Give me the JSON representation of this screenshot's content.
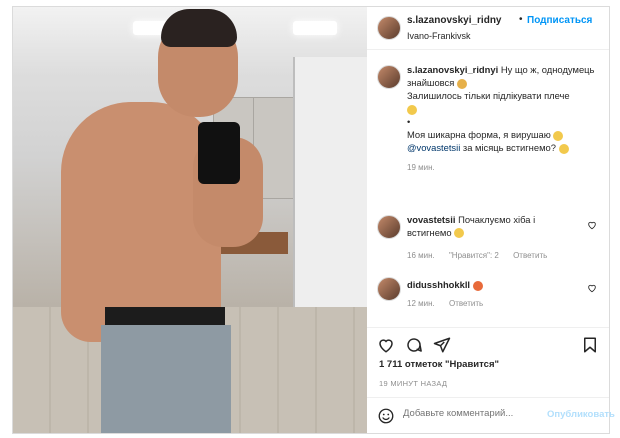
{
  "post": {
    "username": "s.lazanovskyi_ridny",
    "separator": "•",
    "follow_label": "Подписаться",
    "location": "Ivano-Frankivsk",
    "caption": {
      "username": "s.lazanovskyi_ridnyi",
      "line1": "Ну що ж, однодумець знайшовся",
      "line2": "Залишилось тільки підлікувати плече",
      "dot": "•",
      "line3": "Моя шикарна форма, я вирушаю",
      "mention": "@vovastetsii",
      "line4": " за місяць встигнемо?",
      "time": "19 мин."
    },
    "comments": [
      {
        "username": "vovastetsii",
        "text": "Почаклуємо хіба і встигнемо",
        "time": "16 мин.",
        "likes": "\"Нравится\": 2",
        "reply": "Ответить"
      },
      {
        "username": "didusshhokkll",
        "text": "",
        "time": "12 мин.",
        "reply": "Ответить"
      }
    ],
    "likes_count": "1 711 отметок \"Нравится\"",
    "posted_ago": "19 МИНУТ НАЗАД",
    "comment_placeholder": "Добавьте комментарий...",
    "publish_label": "Опубликовать"
  },
  "colors": {
    "accent": "#0095f6",
    "muted": "#8e8e8e",
    "mention": "#00376b",
    "publish_disabled": "#b2dffc"
  },
  "icons": [
    "heart-icon",
    "comment-icon",
    "share-icon",
    "bookmark-icon",
    "emoji-icon"
  ]
}
